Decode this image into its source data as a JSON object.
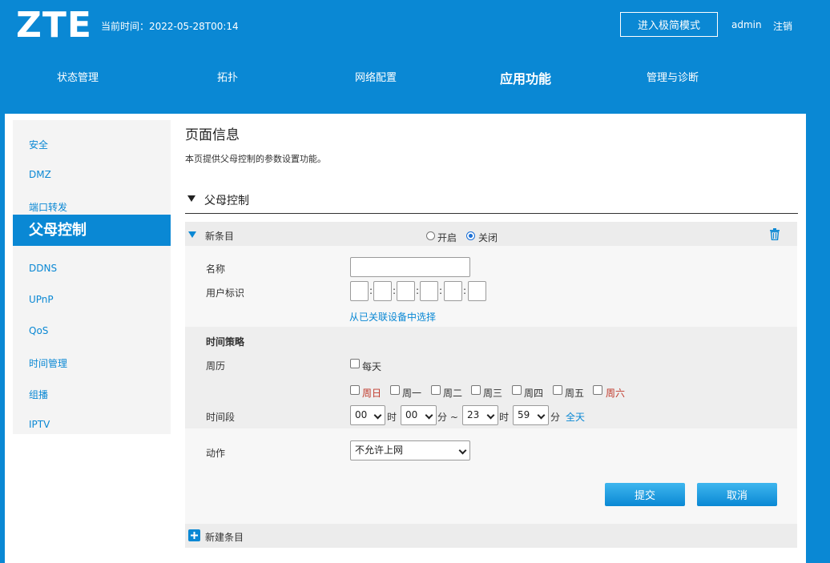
{
  "header": {
    "logo": "ZTE",
    "current_time": "当前时间：2022-05-28T00:14",
    "simple_mode_button": "进入极简模式",
    "user": "admin",
    "logout": "注销"
  },
  "nav": [
    {
      "label": "状态管理",
      "active": false
    },
    {
      "label": "拓扑",
      "active": false
    },
    {
      "label": "网络配置",
      "active": false
    },
    {
      "label": "应用功能",
      "active": true
    },
    {
      "label": "管理与诊断",
      "active": false
    }
  ],
  "sidebar": {
    "items": [
      "安全",
      "DMZ",
      "端口转发",
      "父母控制",
      "DDNS",
      "UPnP",
      "QoS",
      "时间管理",
      "组播",
      "IPTV"
    ],
    "active_index": 3
  },
  "page": {
    "title": "页面信息",
    "description": "本页提供父母控制的参数设置功能。",
    "section_title": "父母控制"
  },
  "entry": {
    "title": "新条目",
    "radio_on": "开启",
    "radio_off": "关闭",
    "selected": "关闭",
    "name_label": "名称",
    "name_value": "",
    "mac_label": "用户标识",
    "mac_sep": ":",
    "select_device_link": "从已关联设备中选择",
    "time_policy_label": "时间策略",
    "calendar_label": "周历",
    "every_day": "每天",
    "days": [
      "周日",
      "周一",
      "周二",
      "周三",
      "周四",
      "周五",
      "周六"
    ],
    "period_label": "时间段",
    "start_hour": "00",
    "hour_unit": "时",
    "start_minute": "00",
    "minute_unit_range": "分 ~",
    "end_hour": "23",
    "end_minute": "59",
    "minute_unit": "分",
    "all_day_link": "全天",
    "action_label": "动作",
    "action_value": "不允许上网",
    "submit": "提交",
    "cancel": "取消"
  },
  "new_entry": "新建条目",
  "colors": {
    "accent": "#0a88d4",
    "weekend": "#c0392b"
  }
}
